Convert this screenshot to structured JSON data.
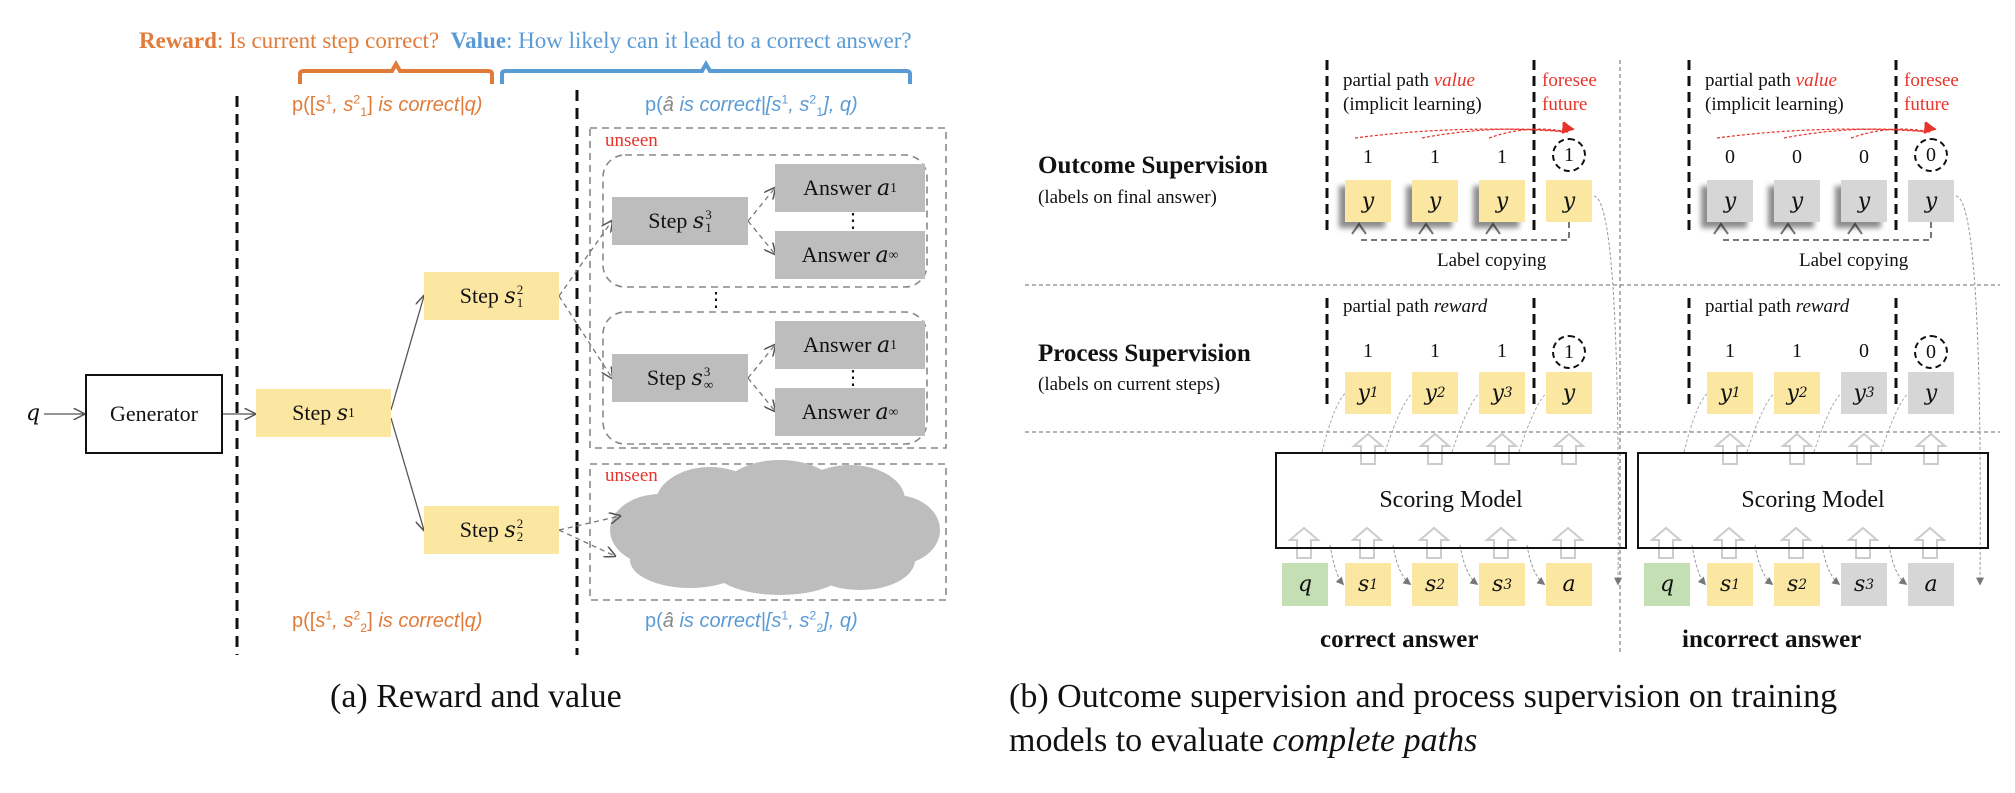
{
  "panel_a": {
    "header": {
      "reward_label": "Reward",
      "reward_question": ": Is current step correct?",
      "value_label": "Value",
      "value_question": ": How likely can it lead to a correct answer?"
    },
    "formulas": {
      "reward_top": {
        "prefix": "p([",
        "s": "s",
        "sup1": "1",
        "sep": ", s",
        "sup2": "2",
        "sub2": "1",
        "suffix": "] ",
        "is_correct": "is correct",
        "cond": "|q)"
      },
      "value_top": {
        "prefix": "p(",
        "ahat": "â",
        "is_correct": " is correct",
        "cond": "|[s",
        "sup1": "1",
        "sep": ", s",
        "sup2": "2",
        "sub2": "1",
        "suffix": "], q)"
      },
      "reward_bottom": {
        "prefix": "p([",
        "s": "s",
        "sup1": "1",
        "sep": ", s",
        "sup2": "2",
        "sub2": "2",
        "suffix": "] ",
        "is_correct": "is correct",
        "cond": "|q)"
      },
      "value_bottom": {
        "prefix": "p(",
        "ahat": "â",
        "is_correct": " is correct",
        "cond": "|[s",
        "sup1": "1",
        "sep": ", s",
        "sup2": "2",
        "sub2": "2",
        "suffix": "], q)"
      }
    },
    "q_label": "q",
    "generator_label": "Generator",
    "step_s1": {
      "word": "Step ",
      "var": "s",
      "sup": "1"
    },
    "step_s1_2": {
      "word": "Step ",
      "var": "s",
      "sup": "2",
      "sub": "1"
    },
    "step_s2_2": {
      "word": "Step ",
      "var": "s",
      "sup": "2",
      "sub": "2"
    },
    "unseen_label": "unseen",
    "step_s1_3": {
      "word": "Step ",
      "var": "s",
      "sup": "3",
      "sub": "1"
    },
    "step_sinf_3": {
      "word": "Step ",
      "var": "s",
      "sup": "3",
      "sub": "∞"
    },
    "answer_a1": {
      "word": "Answer ",
      "var": "a",
      "sub": "1"
    },
    "answer_ainf": {
      "word": "Answer ",
      "var": "a",
      "sub": "∞"
    },
    "vdots": "⋮",
    "caption": "(a)  Reward and value"
  },
  "panel_b": {
    "outcome": {
      "title": "Outcome Supervision",
      "subtitle": "(labels on final answer)"
    },
    "process": {
      "title": "Process Supervision",
      "subtitle": "(labels on current steps)"
    },
    "partial_value": {
      "prefix": "partial path ",
      "emph": "value",
      "line2": "(implicit learning)"
    },
    "foresee": {
      "line1": "foresee",
      "line2": "future"
    },
    "partial_reward": {
      "prefix": "partial path ",
      "emph": "reward"
    },
    "label_copying": "Label copying",
    "scoring_model": "Scoring Model",
    "y": "y",
    "columns": [
      {
        "name": "correct answer",
        "outcome_labels": [
          "1",
          "1",
          "1"
        ],
        "outcome_final": "1",
        "process_labels": [
          "1",
          "1",
          "1"
        ],
        "process_final": "1",
        "process_y": [
          {
            "v": "y",
            "sup": "1",
            "state": "correct"
          },
          {
            "v": "y",
            "sup": "2",
            "state": "correct"
          },
          {
            "v": "y",
            "sup": "3",
            "state": "correct"
          },
          {
            "v": "y",
            "sup": "",
            "state": "correct"
          }
        ],
        "outcome_state": "correct",
        "inputs": [
          {
            "v": "q",
            "sup": "",
            "state": "question"
          },
          {
            "v": "s",
            "sup": "1",
            "state": "correct"
          },
          {
            "v": "s",
            "sup": "2",
            "state": "correct"
          },
          {
            "v": "s",
            "sup": "3",
            "state": "correct"
          },
          {
            "v": "a",
            "sup": "",
            "state": "correct"
          }
        ]
      },
      {
        "name": "incorrect answer",
        "outcome_labels": [
          "0",
          "0",
          "0"
        ],
        "outcome_final": "0",
        "process_labels": [
          "1",
          "1",
          "0"
        ],
        "process_final": "0",
        "process_y": [
          {
            "v": "y",
            "sup": "1",
            "state": "correct"
          },
          {
            "v": "y",
            "sup": "2",
            "state": "correct"
          },
          {
            "v": "y",
            "sup": "3",
            "state": "incorrect"
          },
          {
            "v": "y",
            "sup": "",
            "state": "incorrect"
          }
        ],
        "outcome_state": "incorrect",
        "inputs": [
          {
            "v": "q",
            "sup": "",
            "state": "question"
          },
          {
            "v": "s",
            "sup": "1",
            "state": "correct"
          },
          {
            "v": "s",
            "sup": "2",
            "state": "correct"
          },
          {
            "v": "s",
            "sup": "3",
            "state": "incorrect"
          },
          {
            "v": "a",
            "sup": "",
            "state": "incorrect"
          }
        ]
      }
    ],
    "caption_line1": "(b)  Outcome supervision and process supervision on training",
    "caption_line2_prefix": "models to evaluate ",
    "caption_line2_emph": "complete paths"
  },
  "colors": {
    "reward": "#E07B39",
    "value": "#5B9BD5",
    "highlight_red": "#E8332B",
    "step_yellow": "#FBE6A2",
    "unseen_gray": "#BDBDBD",
    "incorrect_gray": "#D6D6D6",
    "question_green": "#C5DFB4"
  }
}
